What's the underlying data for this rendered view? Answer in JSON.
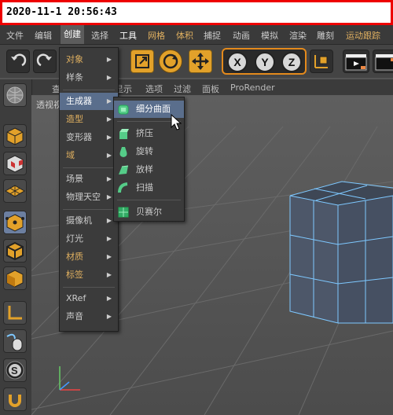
{
  "timestamp": "2020-11-1 20:56:43",
  "menubar": [
    "文件",
    "编辑",
    "创建",
    "选择",
    "工具",
    "网格",
    "体积",
    "捕捉",
    "动画",
    "模拟",
    "渲染",
    "雕刻",
    "运动跟踪"
  ],
  "menubar_colors": [
    "#ccc",
    "#ccc",
    "#ffffff",
    "#ccc",
    "#ffffff",
    "#e0b060",
    "#e0b060",
    "#ccc",
    "#ccc",
    "#ccc",
    "#ccc",
    "#ccc",
    "#e0b060"
  ],
  "toolbar": {
    "axes": [
      "X",
      "Y",
      "Z"
    ]
  },
  "tabs": [
    "查",
    "显示",
    "选项",
    "过滤",
    "面板",
    "ProRender"
  ],
  "viewport": {
    "label": "透视视"
  },
  "create_menu": {
    "items": [
      {
        "label": "对象",
        "color": "#e0b060",
        "arrow": true
      },
      {
        "label": "样条",
        "color": "#ccc",
        "arrow": true
      },
      {
        "sep": true
      },
      {
        "label": "生成器",
        "color": "#ffffff",
        "arrow": true,
        "highlight": true
      },
      {
        "label": "造型",
        "color": "#e0b060",
        "arrow": true
      },
      {
        "label": "变形器",
        "color": "#ccc",
        "arrow": true
      },
      {
        "label": "域",
        "color": "#e0b060",
        "arrow": true
      },
      {
        "sep": true
      },
      {
        "label": "场景",
        "color": "#ccc",
        "arrow": true
      },
      {
        "label": "物理天空",
        "color": "#ccc",
        "arrow": true
      },
      {
        "sep": true
      },
      {
        "label": "摄像机",
        "color": "#ccc",
        "arrow": true
      },
      {
        "label": "灯光",
        "color": "#ccc",
        "arrow": true
      },
      {
        "label": "材质",
        "color": "#e0b060",
        "arrow": true
      },
      {
        "label": "标签",
        "color": "#e0b060",
        "arrow": true
      },
      {
        "sep": true
      },
      {
        "label": "XRef",
        "color": "#ccc",
        "arrow": true
      },
      {
        "label": "声音",
        "color": "#ccc",
        "arrow": true
      }
    ]
  },
  "generator_menu": {
    "items": [
      {
        "label": "细分曲面",
        "highlight": true,
        "icon": "subdivision-surface-icon"
      },
      {
        "sep": true
      },
      {
        "label": "挤压",
        "icon": "extrude-icon"
      },
      {
        "label": "旋转",
        "icon": "lathe-icon"
      },
      {
        "label": "放样",
        "icon": "loft-icon"
      },
      {
        "label": "扫描",
        "icon": "sweep-icon"
      },
      {
        "sep": true
      },
      {
        "label": "贝赛尔",
        "icon": "bezier-icon"
      }
    ]
  },
  "colors": {
    "accent": "#e2a12a",
    "highlight": "#5a6e8c",
    "menu_bg": "#3b3b3b",
    "viewport_cube": "#4a5566",
    "cube_edges": "#7ec8ff"
  }
}
